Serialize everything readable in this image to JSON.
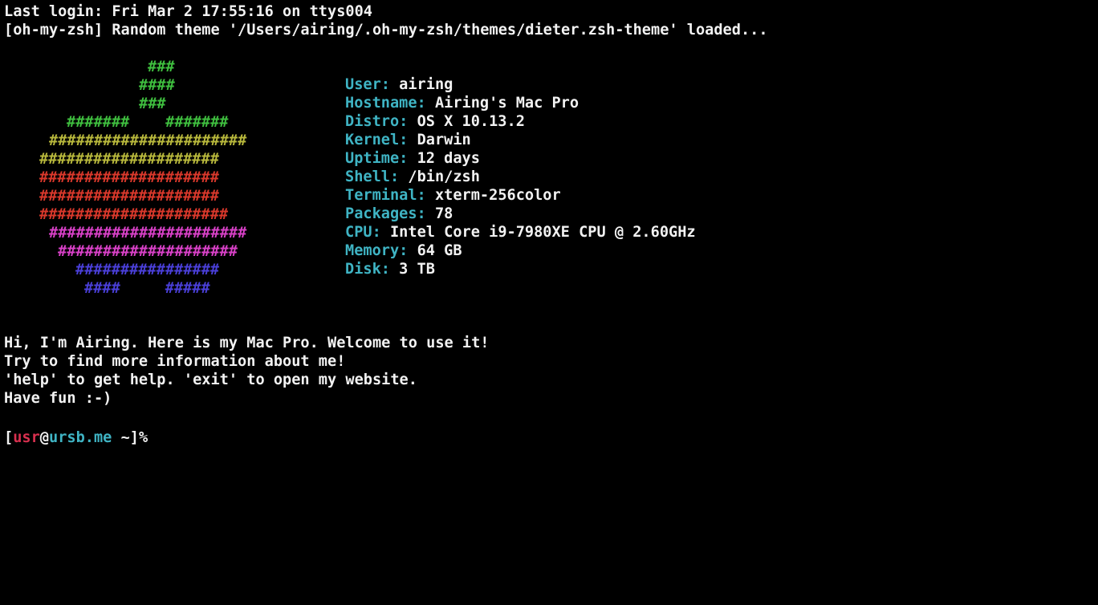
{
  "login_line": "Last login: Fri Mar 2 17:55:16 on ttys004",
  "theme_line": "[oh-my-zsh] Random theme '/Users/airing/.oh-my-zsh/themes/dieter.zsh-theme' loaded...",
  "logo": {
    "rows": [
      {
        "text": "###",
        "color": "#3fbf3f"
      },
      {
        "text": "####",
        "color": "#3fbf3f"
      },
      {
        "text": "###",
        "color": "#3fbf3f"
      },
      {
        "text": "#######    #######",
        "color": "#3fbf3f"
      },
      {
        "text": "######################",
        "color": "#b8b83c"
      },
      {
        "text": "####################",
        "color": "#b8b83c"
      },
      {
        "text": "####################",
        "color": "#d9382b"
      },
      {
        "text": "####################",
        "color": "#d9382b"
      },
      {
        "text": "#####################",
        "color": "#d9382b"
      },
      {
        "text": "######################",
        "color": "#d941c8"
      },
      {
        "text": "####################",
        "color": "#d941c8"
      },
      {
        "text": "################",
        "color": "#4a3fd9"
      },
      {
        "text": "####     #####",
        "color": "#4a3fd9"
      }
    ]
  },
  "info": {
    "rows": [
      {
        "key": "User: ",
        "value": "airing"
      },
      {
        "key": "Hostname: ",
        "value": "Airing's Mac Pro"
      },
      {
        "key": "Distro: ",
        "value": "OS X 10.13.2"
      },
      {
        "key": "Kernel: ",
        "value": "Darwin"
      },
      {
        "key": "Uptime: ",
        "value": "12 days"
      },
      {
        "key": "Shell: ",
        "value": "/bin/zsh"
      },
      {
        "key": "Terminal: ",
        "value": "xterm-256color"
      },
      {
        "key": "Packages: ",
        "value": "78"
      },
      {
        "key": "CPU: ",
        "value": "Intel Core i9-7980XE CPU @ 2.60GHz"
      },
      {
        "key": "Memory: ",
        "value": "64 GB"
      },
      {
        "key": "Disk: ",
        "value": "3 TB"
      }
    ]
  },
  "welcome": {
    "line1": "Hi, I'm Airing. Here is my Mac Pro. Welcome to use it!",
    "line2": "Try to find more information about me!",
    "line3": "'help' to get help. 'exit' to open my website.",
    "line4": "Have fun :-)"
  },
  "prompt": {
    "open_bracket": "[",
    "user": "usr",
    "at": "@",
    "host": "ursb.me",
    "path": " ~]",
    "symbol": "%"
  },
  "colors": {
    "background": "#000000",
    "foreground": "#f2f2f2",
    "key_cyan": "#3fb4c4",
    "prompt_user_red": "#d9304f"
  }
}
